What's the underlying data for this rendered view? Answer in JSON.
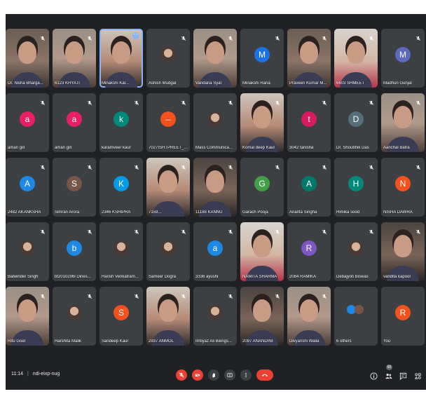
{
  "meeting": {
    "time": "11:14",
    "code": "ndi-eixp-nug",
    "participant_count": "60"
  },
  "tiles": [
    {
      "name": "Dr. Nisha Bharga...",
      "type": "camera",
      "tone": "c1"
    },
    {
      "name": "6123 KHYATI",
      "type": "camera",
      "tone": "c2"
    },
    {
      "name": "Minakshi Kal...",
      "type": "camera",
      "tone": "c3",
      "active": true
    },
    {
      "name": "Ashish Mudgal",
      "type": "photo"
    },
    {
      "name": "Vandana Syal",
      "type": "camera",
      "tone": "c2"
    },
    {
      "name": "Minakshi Rana",
      "type": "letter",
      "letter": "M",
      "color": "#1a73e8"
    },
    {
      "name": "Praveen Kumar M...",
      "type": "camera",
      "tone": "c1"
    },
    {
      "name": "6603 SHMEET",
      "type": "camera",
      "tone": "c4"
    },
    {
      "name": "Madhuri Gunjal",
      "type": "letter",
      "letter": "M",
      "color": "#5c6bc0"
    },
    {
      "name": "aman gill",
      "type": "letter",
      "letter": "a",
      "color": "#e91e63"
    },
    {
      "name": "aman gill",
      "type": "letter",
      "letter": "a",
      "color": "#e91e63"
    },
    {
      "name": "karamveer kaur",
      "type": "letter",
      "letter": "k",
      "color": "#00897b"
    },
    {
      "name": "7027ISHTPREET_...",
      "type": "letter",
      "letter": "–",
      "color": "#f4511e"
    },
    {
      "name": "Mass Communica...",
      "type": "photo"
    },
    {
      "name": "Komal deep Kaur",
      "type": "camera",
      "tone": "c3"
    },
    {
      "name": "3042 tanisha",
      "type": "letter",
      "letter": "t",
      "color": "#d81b60"
    },
    {
      "name": "Dr. Shoubhik Das",
      "type": "letter",
      "letter": "D",
      "color": "#546e7a"
    },
    {
      "name": "Aanchal Batra",
      "type": "camera",
      "tone": "c2"
    },
    {
      "name": "2482 AKANKSHA",
      "type": "letter",
      "letter": "A",
      "color": "#1e88e5"
    },
    {
      "name": "Simran Arora",
      "type": "letter",
      "letter": "S",
      "color": "#795548"
    },
    {
      "name": "2346 KSHIPRA",
      "type": "letter",
      "letter": "K",
      "color": "#039be5"
    },
    {
      "name": "7159...",
      "type": "camera",
      "tone": "c3"
    },
    {
      "name": "11188 KANNU",
      "type": "camera",
      "tone": "c5"
    },
    {
      "name": "Garach Pooja",
      "type": "letter",
      "letter": "G",
      "color": "#43a047"
    },
    {
      "name": "Ananta Singha",
      "type": "letter",
      "letter": "A",
      "color": "#00796b"
    },
    {
      "name": "Himika sood",
      "type": "letter",
      "letter": "H",
      "color": "#00897b"
    },
    {
      "name": "NISHA DAWRA",
      "type": "letter",
      "letter": "N",
      "color": "#f4511e"
    },
    {
      "name": "Balwinder Singh",
      "type": "photo"
    },
    {
      "name": "bt2010206l Dines...",
      "type": "letter",
      "letter": "b",
      "color": "#1e88e5"
    },
    {
      "name": "Harish Venkatram...",
      "type": "photo"
    },
    {
      "name": "Sameer Dogra",
      "type": "photo"
    },
    {
      "name": "3336 ayushi",
      "type": "letter",
      "letter": "a",
      "color": "#1e88e5"
    },
    {
      "name": "NAMITA SHARMA",
      "type": "camera",
      "tone": "c4"
    },
    {
      "name": "2084 RAMIKA",
      "type": "letter",
      "letter": "R",
      "color": "#7e57c2"
    },
    {
      "name": "Debajyoti Biswas",
      "type": "photo"
    },
    {
      "name": "vandita kapoor",
      "type": "camera",
      "tone": "c5"
    },
    {
      "name": "Ritu Goel",
      "type": "camera",
      "tone": "c2"
    },
    {
      "name": "Harshita Malik",
      "type": "photo"
    },
    {
      "name": "Sandeep Kaur",
      "type": "letter",
      "letter": "S",
      "color": "#f4511e"
    },
    {
      "name": "2937 ANMOL",
      "type": "camera",
      "tone": "c3"
    },
    {
      "name": "Imtiyaz Ali Beings...",
      "type": "photo"
    },
    {
      "name": "2097 ANANDINI",
      "type": "camera",
      "tone": "c5"
    },
    {
      "name": "Divyanshi Walia",
      "type": "camera",
      "tone": "c2"
    },
    {
      "name": "6 others",
      "type": "others"
    },
    {
      "name": "You",
      "type": "letter",
      "letter": "R",
      "color": "#f4511e",
      "self": true
    }
  ],
  "icons": {
    "mic_off": "mic-off-icon",
    "cam_off": "camera-off-icon",
    "hand": "raise-hand-icon",
    "present": "present-screen-icon",
    "more": "more-options-icon",
    "end": "end-call-icon",
    "info": "info-icon",
    "people": "people-icon",
    "chat": "chat-icon",
    "activities": "activities-icon"
  }
}
